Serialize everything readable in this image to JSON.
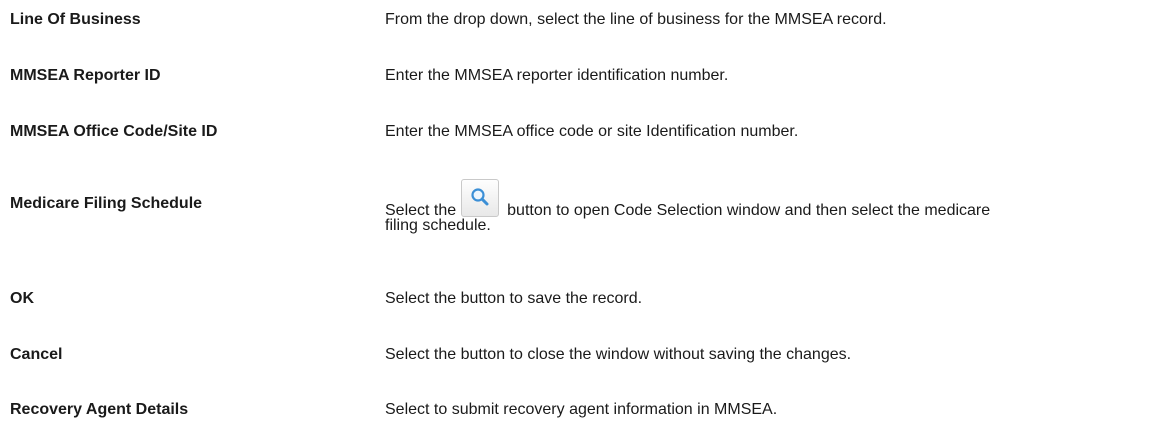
{
  "rows": [
    {
      "term": "Line Of Business",
      "description": "From the drop down, select the line of business for the MMSEA record."
    },
    {
      "term": "MMSEA Reporter ID",
      "description": "Enter the MMSEA reporter  identification number."
    },
    {
      "term": "MMSEA Office Code/Site ID",
      "description": "Enter the MMSEA office code or site Identification number."
    },
    {
      "term": "Medicare Filing Schedule",
      "description_before": "Select the",
      "description_icon": "search-icon",
      "description_after": "button to open Code Selection window and then select the  medicare",
      "description_line2": "filing schedule."
    },
    {
      "term": "OK",
      "description": "Select the button to save the record."
    },
    {
      "term": "Cancel",
      "description": "Select the button to close the window without saving the changes."
    },
    {
      "term": "Recovery Agent Details",
      "description": "Select to submit recovery agent information in MMSEA."
    }
  ]
}
